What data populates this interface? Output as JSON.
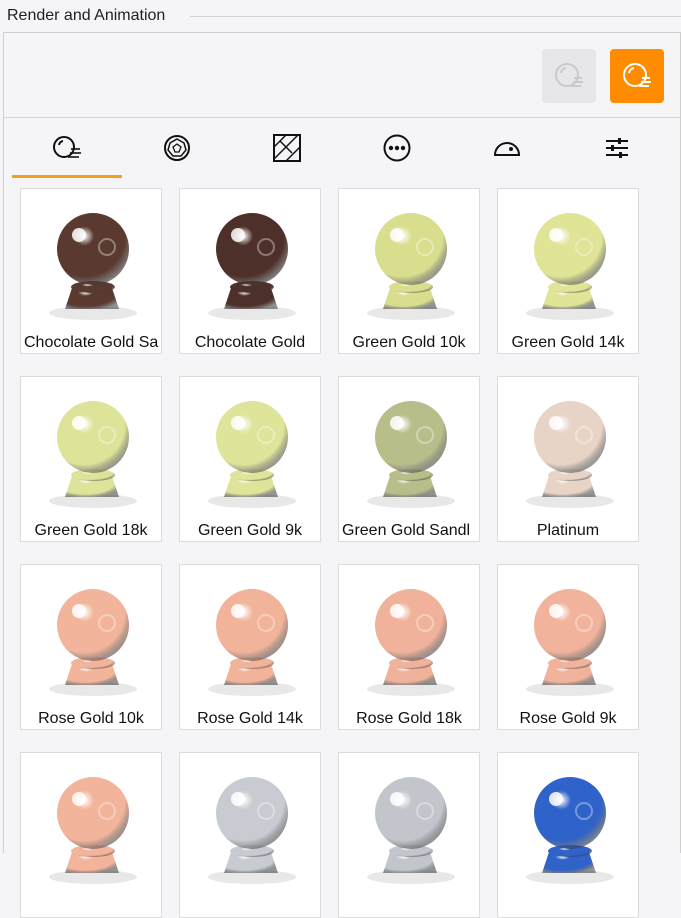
{
  "panel": {
    "title": "Render and Animation"
  },
  "toolbar": {
    "buttons": [
      {
        "icon": "render-sphere-icon",
        "state": "disabled"
      },
      {
        "icon": "render-sphere-icon",
        "state": "active",
        "color": "#ff8c00"
      }
    ]
  },
  "tabs": [
    {
      "icon": "material-sphere-icon",
      "selected": true
    },
    {
      "icon": "gemstone-icon",
      "selected": false
    },
    {
      "icon": "texture-pattern-icon",
      "selected": false
    },
    {
      "icon": "more-options-icon",
      "selected": false
    },
    {
      "icon": "dome-environment-icon",
      "selected": false
    },
    {
      "icon": "sliders-settings-icon",
      "selected": false
    }
  ],
  "accent_color": "#f0a31a",
  "materials": [
    {
      "label": "Chocolate Gold Sa",
      "color": "#5a3a30",
      "clipped": true
    },
    {
      "label": "Chocolate Gold",
      "color": "#4e302a",
      "clipped": false
    },
    {
      "label": "Green Gold 10k",
      "color": "#d9de8e",
      "clipped": false
    },
    {
      "label": "Green Gold 14k",
      "color": "#dfe496",
      "clipped": false
    },
    {
      "label": "Green Gold 18k",
      "color": "#dde398",
      "clipped": false
    },
    {
      "label": "Green Gold 9k",
      "color": "#dee499",
      "clipped": false
    },
    {
      "label": "Green Gold Sandl",
      "color": "#b9bd8a",
      "clipped": true
    },
    {
      "label": "Platinum",
      "color": "#e8d4c6",
      "clipped": false
    },
    {
      "label": "Rose Gold 10k",
      "color": "#f2b49a",
      "clipped": false
    },
    {
      "label": "Rose Gold 14k",
      "color": "#f1b39a",
      "clipped": false
    },
    {
      "label": "Rose Gold 18k",
      "color": "#f0b29a",
      "clipped": false
    },
    {
      "label": "Rose Gold 9k",
      "color": "#f1b39b",
      "clipped": false
    },
    {
      "label": "",
      "color": "#f3b49c",
      "clipped": false
    },
    {
      "label": "",
      "color": "#c8ccd2",
      "clipped": false
    },
    {
      "label": "",
      "color": "#c2c6cc",
      "clipped": false
    },
    {
      "label": "",
      "color": "#2f63c9",
      "clipped": false
    }
  ]
}
